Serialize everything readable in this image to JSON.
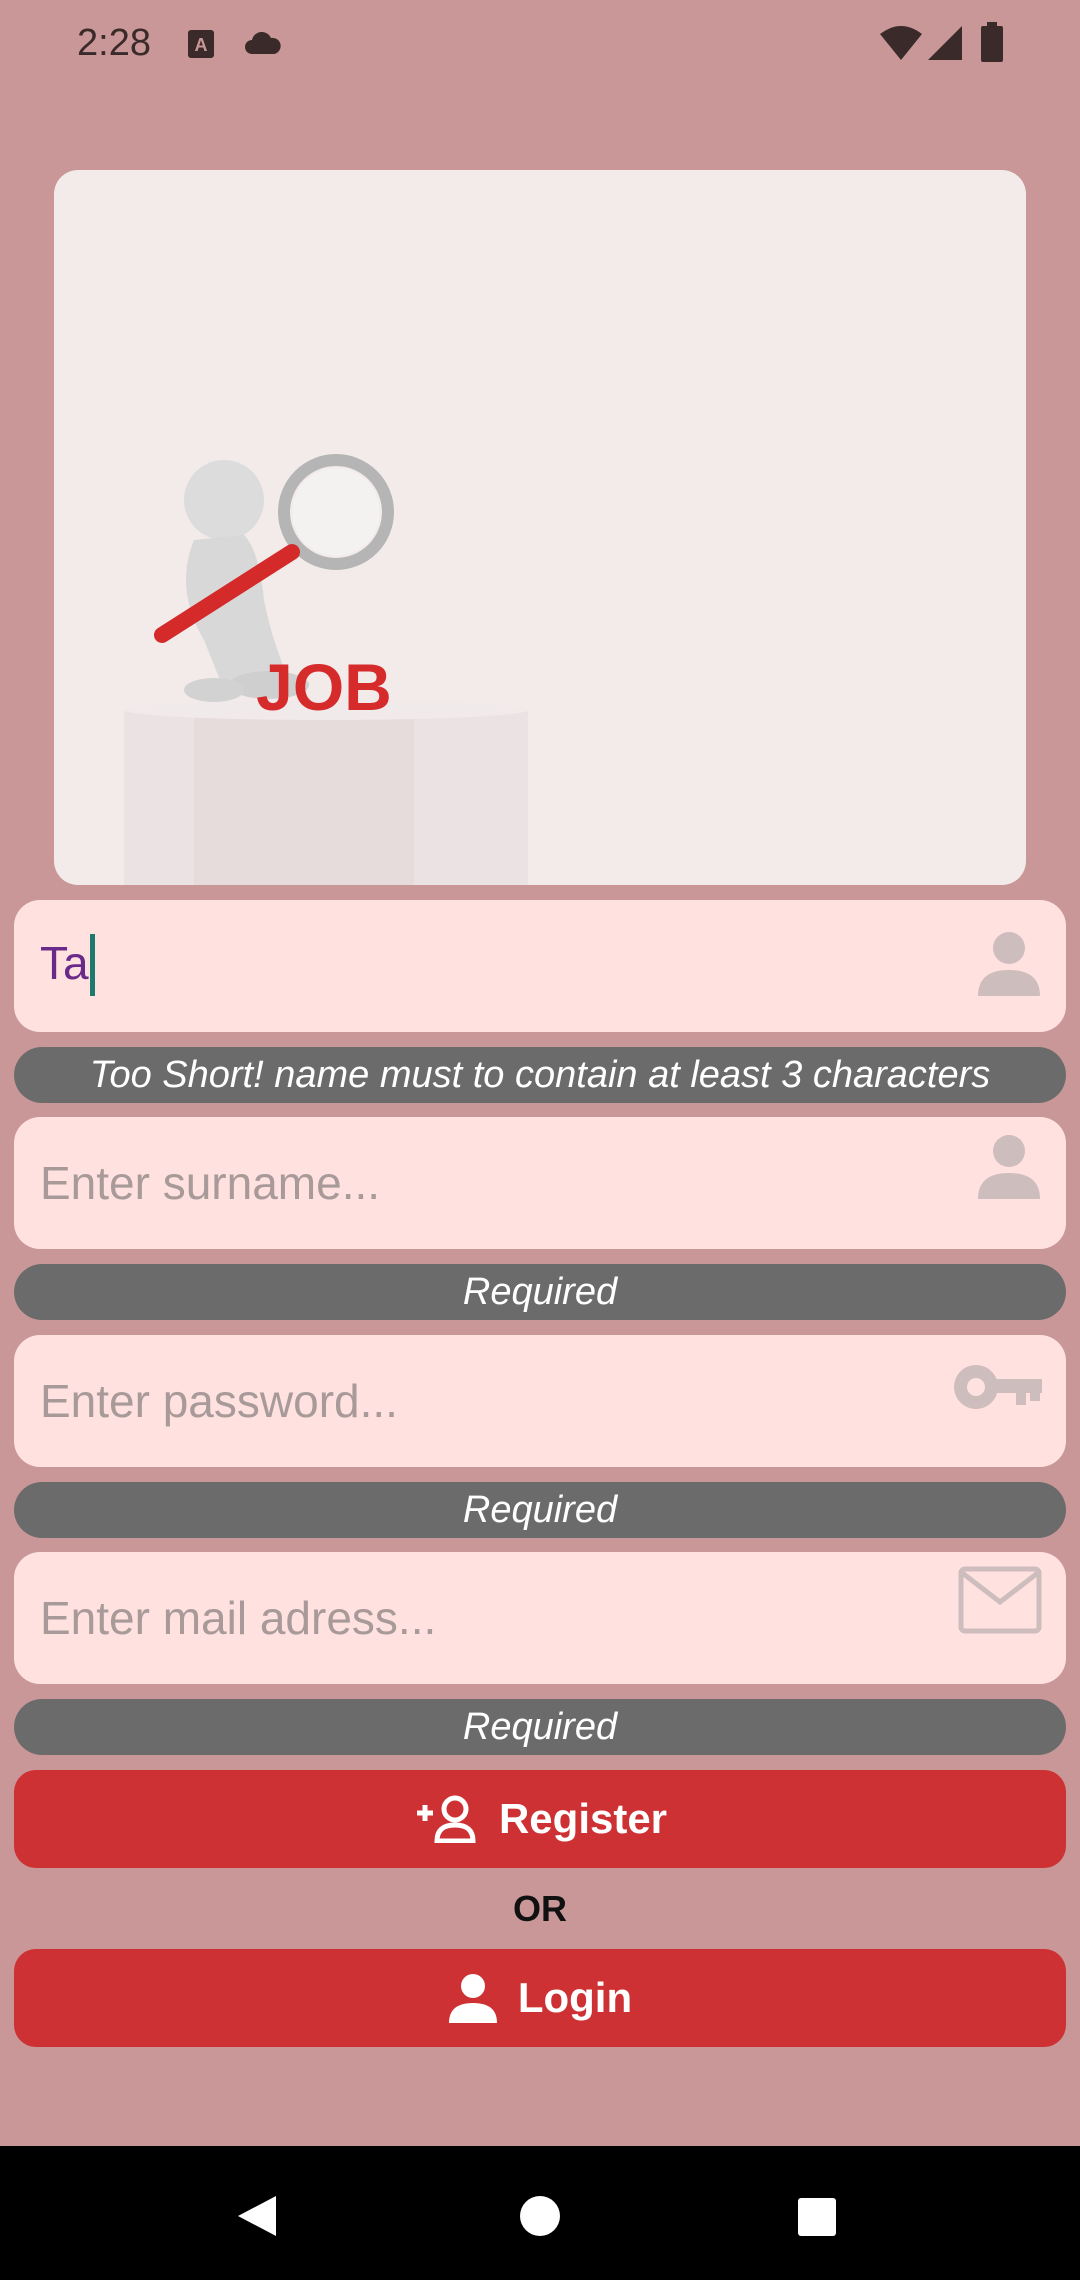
{
  "status_bar": {
    "time": "2:28",
    "left_icons": [
      "keyboard-icon",
      "cloud-icon"
    ],
    "right_icons": [
      "wifi-icon",
      "signal-icon",
      "battery-icon"
    ]
  },
  "hero": {
    "image": "job-search-figure-illustration",
    "image_text": "JOB"
  },
  "form": {
    "name": {
      "value": "Ta",
      "icon": "person-icon",
      "error": "Too Short! name must to contain at least 3 characters"
    },
    "surname": {
      "value": "",
      "placeholder": "Enter surname...",
      "icon": "person-icon",
      "error": "Required"
    },
    "password": {
      "value": "",
      "placeholder": "Enter password...",
      "icon": "key-icon",
      "error": "Required"
    },
    "mail": {
      "value": "",
      "placeholder": "Enter mail adress...",
      "icon": "mail-icon",
      "error": "Required"
    }
  },
  "actions": {
    "register_label": "Register",
    "register_icon": "add-user-icon",
    "or_label": "OR",
    "login_label": "Login",
    "login_icon": "person-icon"
  },
  "nav_bar": {
    "buttons": [
      "back-icon",
      "home-icon",
      "recents-icon"
    ]
  },
  "colors": {
    "background": "#c99797",
    "field_bg": "#ffe1e0",
    "error_pill": "#6b6b6b",
    "button": "#cd3133",
    "typed_text": "#6a2a8a"
  }
}
